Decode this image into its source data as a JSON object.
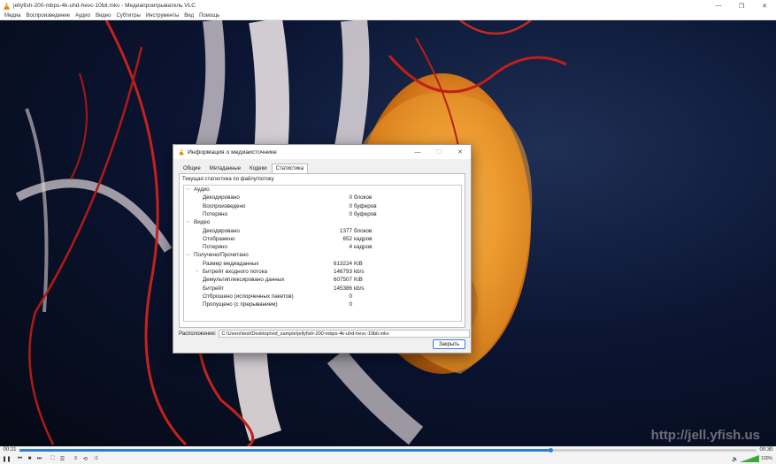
{
  "window": {
    "title": "jellyfish-200-mbps-4k-uhd-hevc-10bit.mkv - Медиапроигрыватель VLC",
    "controls": {
      "minimize": "—",
      "maximize": "❐",
      "close": "✕"
    }
  },
  "menu": [
    "Медиа",
    "Воспроизведение",
    "Аудио",
    "Видео",
    "Субтитры",
    "Инструменты",
    "Вид",
    "Помощь"
  ],
  "watermark": "http://jell.yfish.us",
  "playback": {
    "elapsed": "00:21",
    "total": "00:30",
    "progress": 0.72,
    "volume_label": "100%",
    "volume_level": 1.0
  },
  "controls_icons": [
    "pause-icon",
    "previous-icon",
    "stop-icon",
    "next-icon",
    "fullscreen-icon",
    "extended-settings-icon",
    "playlist-icon",
    "loop-icon",
    "shuffle-icon"
  ],
  "dialog": {
    "title": "Информация о медиаисточнике",
    "tabs": [
      "Общие",
      "Метаданные",
      "Кодеки",
      "Статистика"
    ],
    "active_tab": "Статистика",
    "caption": "Текущая статистика по файлу/потоку",
    "rows": [
      {
        "type": "group",
        "label": "Аудио",
        "expander": "⌵"
      },
      {
        "type": "item",
        "label": "Декодировано",
        "value": "0",
        "unit": "блоков"
      },
      {
        "type": "item",
        "label": "Воспроизведено",
        "value": "0",
        "unit": "буферов"
      },
      {
        "type": "item",
        "label": "Потеряно",
        "value": "0",
        "unit": "буферов"
      },
      {
        "type": "group",
        "label": "Видео",
        "expander": "⌵"
      },
      {
        "type": "item",
        "label": "Декодировано",
        "value": "1377",
        "unit": "блоков"
      },
      {
        "type": "item",
        "label": "Отображено",
        "value": "652",
        "unit": "кадров"
      },
      {
        "type": "item",
        "label": "Потеряно",
        "value": "4",
        "unit": "кадров"
      },
      {
        "type": "group",
        "label": "Получено/Прочитано",
        "expander": "⌵"
      },
      {
        "type": "item",
        "label": "Размер медиаданных",
        "value": "613224",
        "unit": "KiB"
      },
      {
        "type": "item",
        "label": "Битрейт входного потока",
        "value": "146793",
        "unit": "kb/s",
        "expander": "›"
      },
      {
        "type": "item",
        "label": "Демультиплексировано данных",
        "value": "607507",
        "unit": "KiB"
      },
      {
        "type": "item",
        "label": "Битрейт",
        "value": "145386",
        "unit": "kb/s"
      },
      {
        "type": "item",
        "label": "Отброшено (испорченных пакетов)",
        "value": "0",
        "unit": ""
      },
      {
        "type": "item",
        "label": "Пропущено (с прерыванием)",
        "value": "0",
        "unit": ""
      }
    ],
    "location_label": "Расположение:",
    "location_value": "C:\\Users\\test\\Desktop\\vid_sample\\jellyfish-200-mbps-4k-uhd-hevc-10bit.mkv",
    "close_label": "Закрыть"
  }
}
